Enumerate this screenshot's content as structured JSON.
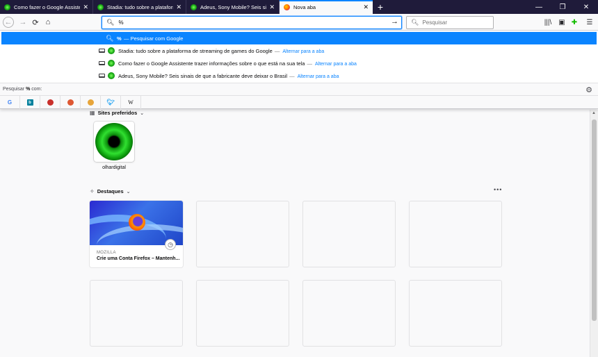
{
  "tabs": [
    {
      "title": "Como fazer o Google Assistente",
      "active": false
    },
    {
      "title": "Stadia: tudo sobre a plataforma",
      "active": false
    },
    {
      "title": "Adeus, Sony Mobile? Seis sinais",
      "active": false
    },
    {
      "title": "Nova aba",
      "active": true
    }
  ],
  "window_controls": {
    "new_tab": "+",
    "minimize": "—",
    "restore": "❐",
    "close": "✕"
  },
  "url": {
    "value": "%",
    "go_icon": "arrow-right-icon"
  },
  "search": {
    "placeholder": "Pesquisar"
  },
  "dropdown": {
    "highlight": {
      "query": "%",
      "action": "— Pesquisar com Google"
    },
    "results": [
      {
        "title": "Stadia: tudo sobre a plataforma de streaming de games do Google",
        "switch": "Alternar para a aba"
      },
      {
        "title": "Como fazer o Google Assistente trazer informações sobre o que está na sua tela",
        "switch": "Alternar para a aba"
      },
      {
        "title": "Adeus, Sony Mobile? Seis sinais de que a fabricante deve deixar o Brasil",
        "switch": "Alternar para a aba"
      }
    ],
    "search_label_prefix": "Pesquisar",
    "search_label_query": "%",
    "search_label_suffix": "com:",
    "engines": [
      "G",
      "b",
      "",
      "",
      "",
      "",
      "W"
    ]
  },
  "newtab": {
    "topsites_title": "Sites preferidos",
    "topsite": {
      "label": "olhardigital"
    },
    "highlights_title": "Destaques",
    "card": {
      "source": "MOZILLA",
      "title": "Crie uma Conta Firefox – Mantenh..."
    }
  },
  "colors": {
    "accent": "#0a84ff",
    "tabbar": "#1f1b3a"
  }
}
